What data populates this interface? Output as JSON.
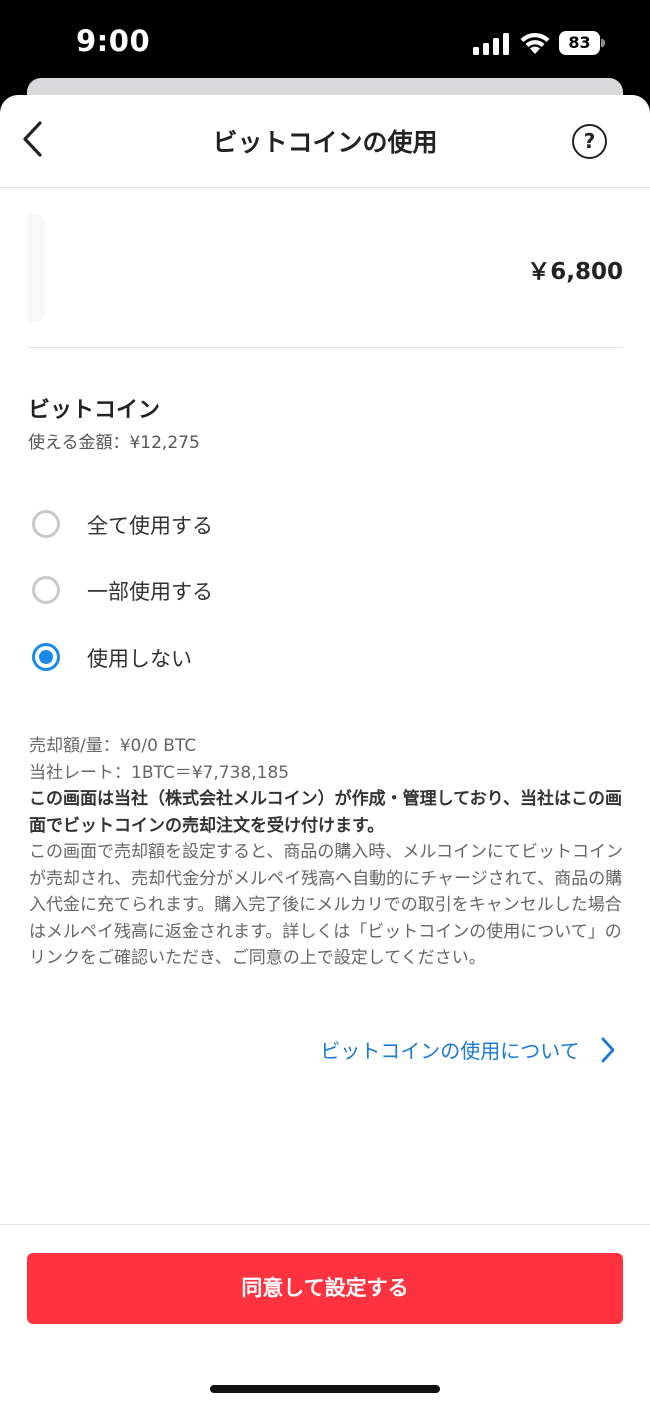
{
  "status_bar": {
    "time": "9:00",
    "battery": "83"
  },
  "header": {
    "title": "ビットコインの使用",
    "help_symbol": "?"
  },
  "product": {
    "price": "￥6,800"
  },
  "bitcoin": {
    "title": "ビットコイン",
    "available": "使える金額：¥12,275",
    "options": [
      {
        "label": "全て使用する",
        "selected": false
      },
      {
        "label": "一部使用する",
        "selected": false
      },
      {
        "label": "使用しない",
        "selected": true
      }
    ]
  },
  "info": {
    "sell_amount": "売却額/量：¥0/0 BTC",
    "rate": "当社レート：1BTC＝¥7,738,185",
    "bold_notice": "この画面は当社（株式会社メルコイン）が作成・管理しており、当社はこの画面でビットコインの売却注文を受け付けます。",
    "description": "この画面で売却額を設定すると、商品の購入時、メルコインにてビットコインが売却され、売却代金分がメルペイ残高へ自動的にチャージされて、商品の購入代金に充てられます。購入完了後にメルカリでの取引をキャンセルした場合はメルペイ残高に返金されます。詳しくは「ビットコインの使用について」のリンクをご確認いただき、ご同意の上で設定してください。"
  },
  "about_link": "ビットコインの使用について",
  "footer": {
    "agree_button": "同意して設定する"
  },
  "colors": {
    "accent": "#1a8ae8",
    "link": "#1a7ad6",
    "primary_button": "#ff333f"
  },
  "icons": [
    "cellular-signal-icon",
    "wifi-icon",
    "battery-icon",
    "back-arrow-icon",
    "help-icon",
    "chevron-right-icon"
  ]
}
